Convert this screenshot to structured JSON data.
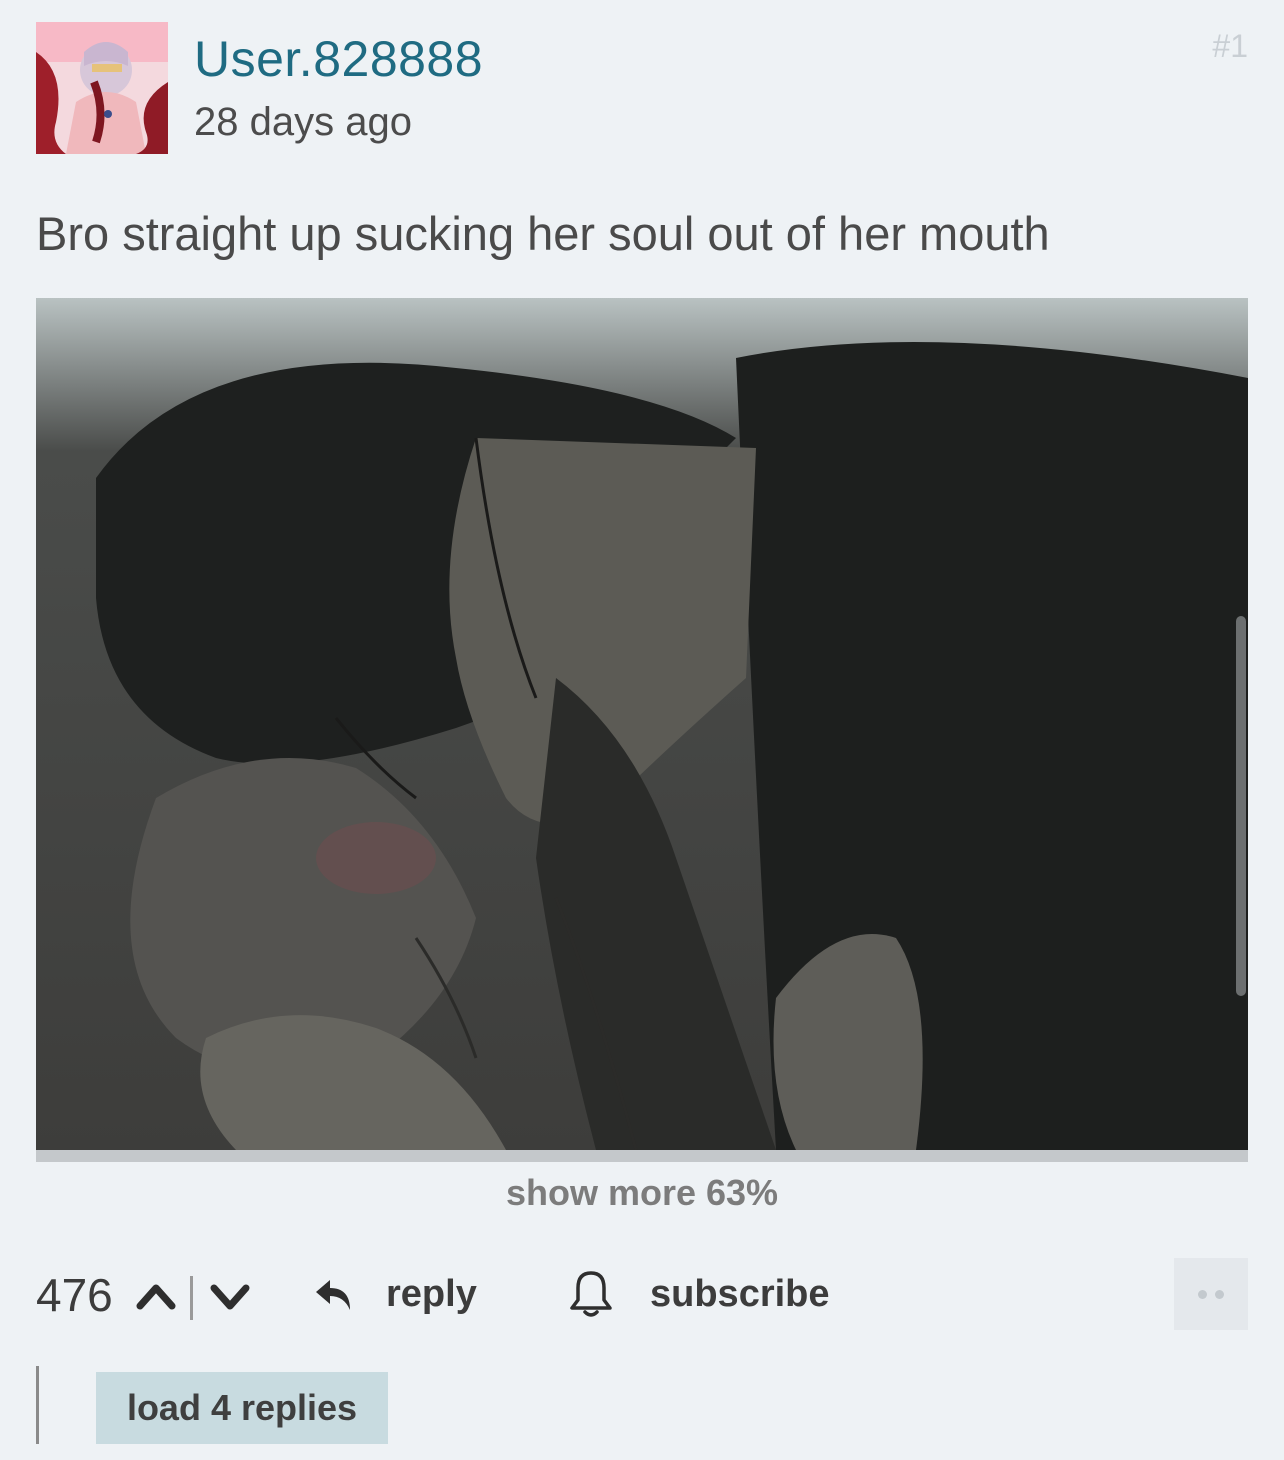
{
  "comment": {
    "username": "User.828888",
    "timestamp": "28 days ago",
    "post_number": "#1",
    "text": "Bro straight up sucking her soul out of her mouth",
    "image": {
      "show_more_label": "show more 63%"
    },
    "avatar_icon": "user-avatar-icon"
  },
  "actions": {
    "vote_count": "476",
    "reply_label": "reply",
    "subscribe_label": "subscribe",
    "icons": [
      "chevron-up-icon",
      "chevron-down-icon",
      "reply-arrow-icon",
      "bell-icon",
      "more-dots-icon"
    ]
  },
  "replies": {
    "load_label": "load 4 replies"
  },
  "colors": {
    "username": "#1f6b82",
    "background": "#eef2f5",
    "load_replies_bg": "#c8dbe0"
  }
}
